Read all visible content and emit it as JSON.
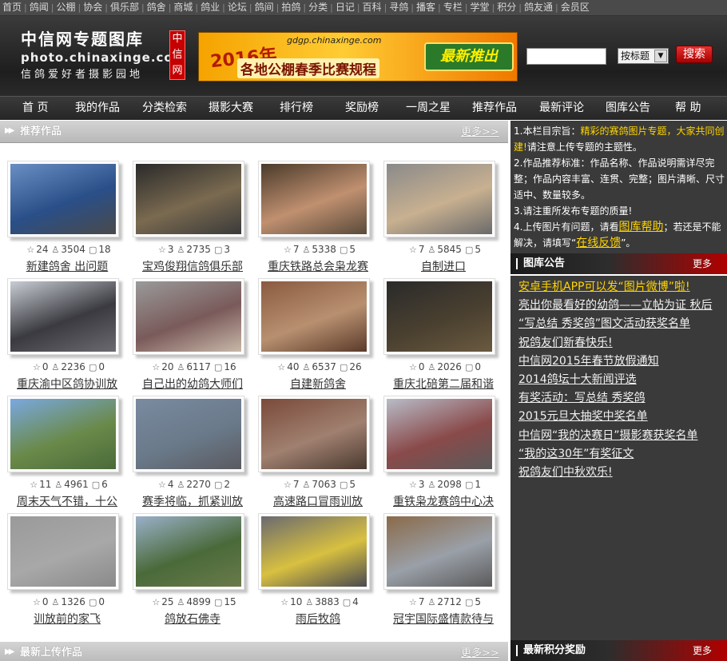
{
  "top_links": [
    "首页",
    "鸽闻",
    "公棚",
    "协会",
    "俱乐部",
    "鸽舍",
    "商城",
    "鸽业",
    "论坛",
    "鸽间",
    "拍鸽",
    "分类",
    "日记",
    "百科",
    "寻鸽",
    "播客",
    "专栏",
    "学堂",
    "积分",
    "鸽友通",
    "会员区"
  ],
  "logo": {
    "cn": "中信网专题图库",
    "en": "photo.chinaxinge.com",
    "slogan": "信鸽爱好者摄影园地",
    "badge": "中信网"
  },
  "banner": {
    "year": "2016年",
    "url": "gdgp.chinaxinge.com",
    "title": "各地公棚春季比赛规程",
    "promo": "最新推出"
  },
  "search": {
    "select_value": "按标题",
    "button": "搜索"
  },
  "main_nav": [
    "首 页",
    "我的作品",
    "分类检索",
    "摄影大赛",
    "排行榜",
    "奖励榜",
    "一周之星",
    "推荐作品",
    "最新评论",
    "图库公告",
    "帮 助"
  ],
  "recommend": {
    "title": "推荐作品",
    "more": "更多>>"
  },
  "latest": {
    "title": "最新上传作品",
    "more": "更多>>"
  },
  "photos": [
    {
      "caption": "新建鸽舍 出问题",
      "likes": "24",
      "views": "3504",
      "comments": "18",
      "colors": [
        "#6a8fc4",
        "#2a4f88",
        "#4a4a4a"
      ]
    },
    {
      "caption": "宝鸡俊翔信鸽俱乐部",
      "likes": "3",
      "views": "2735",
      "comments": "3",
      "colors": [
        "#2a2a2a",
        "#7a6a50",
        "#3a3a3a"
      ]
    },
    {
      "caption": "重庆铁路总会枭龙赛",
      "likes": "7",
      "views": "5338",
      "comments": "5",
      "colors": [
        "#4a3a2a",
        "#c09070",
        "#5a4a3a"
      ]
    },
    {
      "caption": "自制进口",
      "likes": "7",
      "views": "5845",
      "comments": "5",
      "colors": [
        "#8a8a8a",
        "#c8b090",
        "#6a6a6a"
      ]
    },
    {
      "caption": "重庆渝中区鸽协训放",
      "likes": "0",
      "views": "2236",
      "comments": "0",
      "colors": [
        "#c8ccd4",
        "#3a3a40",
        "#6a6a70"
      ]
    },
    {
      "caption": "自己出的幼鸽大师们",
      "likes": "20",
      "views": "6117",
      "comments": "16",
      "colors": [
        "#9a9a9a",
        "#7a5a5a",
        "#c8b8a8"
      ]
    },
    {
      "caption": "自建新鸽舍",
      "likes": "40",
      "views": "6537",
      "comments": "26",
      "colors": [
        "#8a5a40",
        "#b89070",
        "#5a3a2a"
      ]
    },
    {
      "caption": "重庆北碚第二届和谐",
      "likes": "0",
      "views": "2026",
      "comments": "0",
      "colors": [
        "#2a2a2a",
        "#4a4030",
        "#6a5a40"
      ]
    },
    {
      "caption": "周末天气不错，十公",
      "likes": "11",
      "views": "4961",
      "comments": "6",
      "colors": [
        "#7aa8e0",
        "#6a8a4a",
        "#4a6a3a"
      ]
    },
    {
      "caption": "赛季将临，抓紧训放",
      "likes": "4",
      "views": "2270",
      "comments": "2",
      "colors": [
        "#7a8aa0",
        "#6a7a8a",
        "#5a5a60"
      ]
    },
    {
      "caption": "高速路口冒雨训放",
      "likes": "7",
      "views": "7063",
      "comments": "5",
      "colors": [
        "#7a4a3a",
        "#a08070",
        "#4a3a30"
      ]
    },
    {
      "caption": "重铁枭龙赛鸽中心决",
      "likes": "3",
      "views": "2098",
      "comments": "1",
      "colors": [
        "#b8bcc8",
        "#8a4a4a",
        "#5a5a5a"
      ]
    },
    {
      "caption": "训放前的家飞",
      "likes": "0",
      "views": "1326",
      "comments": "0",
      "colors": [
        "#9a9a9a",
        "#a8a8a8",
        "#8a8a8a"
      ]
    },
    {
      "caption": "鸽放石佛寺",
      "likes": "25",
      "views": "4899",
      "comments": "15",
      "colors": [
        "#9ab0c8",
        "#4a6a3a",
        "#6a7a4a"
      ]
    },
    {
      "caption": "雨后牧鸽",
      "likes": "10",
      "views": "3883",
      "comments": "4",
      "colors": [
        "#6a6a70",
        "#d8c040",
        "#4a4a50"
      ]
    },
    {
      "caption": "冠宇国际盛情款待与",
      "likes": "7",
      "views": "2712",
      "comments": "5",
      "colors": [
        "#8a6a4a",
        "#9aa0a8",
        "#5a5a5a"
      ]
    }
  ],
  "notice": {
    "l1_pre": "1.本栏目宗旨：",
    "l1_hl": "精彩的赛鸽图片专题，大家共同创建!",
    "l1_post": "请注意上传专题的主题性。",
    "l2": "2.作品推荐标准：作品名称、作品说明需详尽完整；作品内容丰富、连贯、完整；图片清晰、尺寸适中、数量较多。",
    "l3": "3.请注重所发布专题的质量!",
    "l4_pre": "4.上传图片有问题，请看",
    "l4_link": "图库帮助",
    "l4_mid": "；若还是不能解决，请填写“",
    "l4_link2": "在线反馈",
    "l4_post": "”。"
  },
  "announcements": {
    "title": "图库公告",
    "more": "更多>>",
    "items": [
      "安卓手机APP可以发“图片微博”啦!",
      "亮出你最看好的幼鸽——立帖为证 秋后",
      "“写总结 秀奖鸽”图文活动获奖名单",
      "祝鸽友们新春快乐!",
      "中信网2015年春节放假通知",
      "2014鸽坛十大新闻评选",
      "有奖活动：写总结 秀奖鸽",
      "2015元旦大抽奖中奖名单",
      "中信网“我的决赛日”摄影赛获奖名单",
      "“我的这30年”有奖征文",
      "祝鸽友们中秋欢乐!"
    ]
  },
  "points": {
    "title": "最新积分奖励",
    "more": "更多>>"
  }
}
